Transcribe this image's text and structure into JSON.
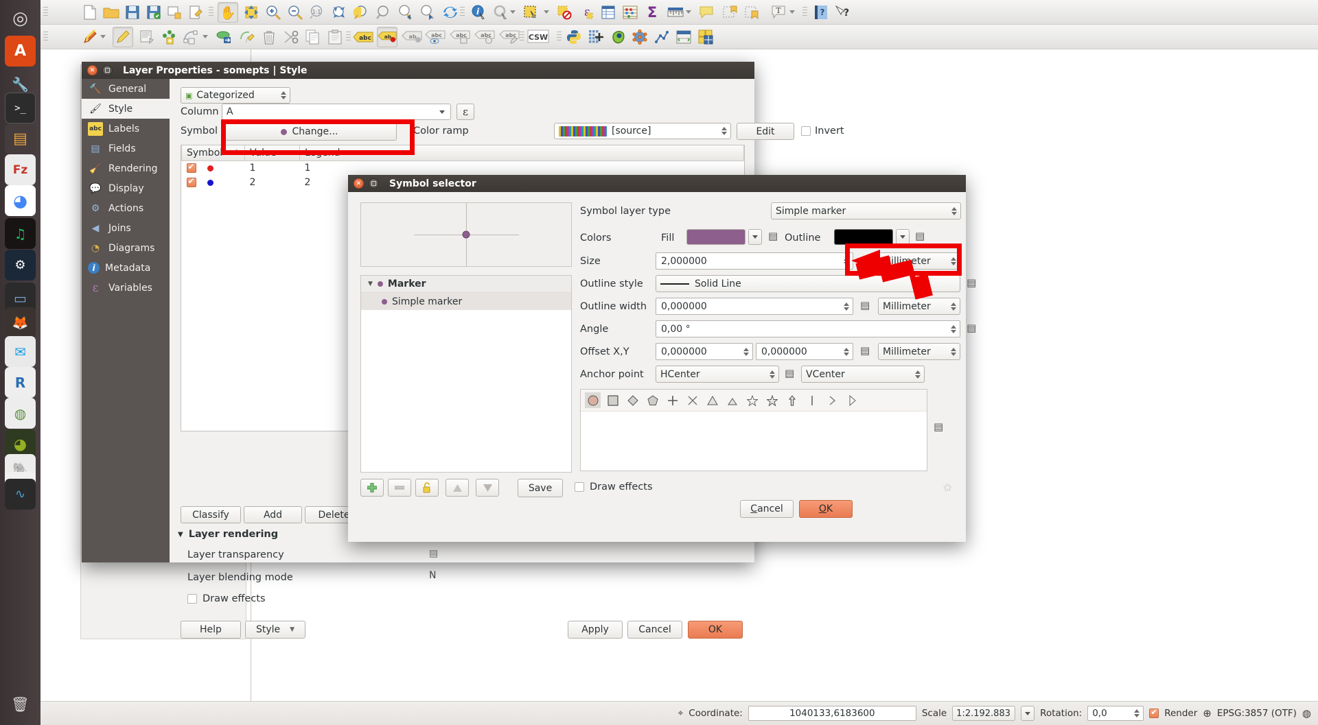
{
  "launcher": {
    "items": [
      {
        "name": "dash-home",
        "glyph": "◎",
        "color": "#d9d6d3",
        "bg": "transparent"
      },
      {
        "name": "app-ubuntu-software",
        "glyph": "A",
        "color": "#ffffff",
        "bg": "#dd4814"
      },
      {
        "name": "app-settings-wrench",
        "glyph": "🔧",
        "color": "#cfcfcf",
        "bg": "transparent"
      },
      {
        "name": "app-terminal",
        "glyph": ">_",
        "color": "#ffffff",
        "bg": "#2c2c2c"
      },
      {
        "name": "app-files",
        "glyph": "▤",
        "color": "#e8a33d",
        "bg": "#4a4042"
      },
      {
        "name": "app-filezilla",
        "glyph": "Fz",
        "color": "#c8362c",
        "bg": "#f0f0f0"
      },
      {
        "name": "app-chrome",
        "glyph": "◕",
        "color": "#4285f4",
        "bg": "#ffffff"
      },
      {
        "name": "app-spotify",
        "glyph": "♫",
        "color": "#1db954",
        "bg": "#191414"
      },
      {
        "name": "app-steam",
        "glyph": "⚙",
        "color": "#ffffff",
        "bg": "#1b2838"
      },
      {
        "name": "app-virtualbox",
        "glyph": "▭",
        "color": "#6d9fd4",
        "bg": "#2b2b2b"
      },
      {
        "name": "app-gimp",
        "glyph": "🦊",
        "color": "#dd8b3a",
        "bg": "#3a3330"
      },
      {
        "name": "app-thunderbird",
        "glyph": "✉",
        "color": "#1e9fe3",
        "bg": "#e8e8e8"
      },
      {
        "name": "app-rstudio",
        "glyph": "R",
        "color": "#2b6fb5",
        "bg": "#e8e8e8"
      },
      {
        "name": "app-qgis-old",
        "glyph": "Q",
        "color": "#5a8f3a",
        "bg": "#e0e0e0"
      },
      {
        "name": "app-qgis",
        "glyph": "Q",
        "color": "#93b023",
        "bg": "#2f3b20"
      },
      {
        "name": "app-pgadmin",
        "glyph": "🐘",
        "color": "#336791",
        "bg": "#e8e8e8"
      },
      {
        "name": "app-system-monitor",
        "glyph": "∿",
        "color": "#4ba3d8",
        "bg": "#2a2a2a"
      },
      {
        "name": "trash",
        "glyph": "🗑",
        "color": "#cfcfcf",
        "bg": "transparent"
      }
    ]
  },
  "toolbar1": {
    "items": [
      {
        "name": "grip-handle",
        "type": "grip"
      },
      {
        "name": "new-project-icon",
        "glyph": "🗎"
      },
      {
        "name": "open-project-icon",
        "glyph": "📂"
      },
      {
        "name": "save-project-icon",
        "glyph": "💾"
      },
      {
        "name": "save-project-as-icon",
        "glyph": "💾"
      },
      {
        "name": "new-print-composer-icon",
        "glyph": "🗋"
      },
      {
        "name": "composer-manager-icon",
        "glyph": "🗒"
      },
      {
        "name": "grip-handle",
        "type": "grip"
      },
      {
        "name": "pan-map-icon",
        "glyph": "✋",
        "pressed": true
      },
      {
        "name": "pan-to-selection-icon",
        "glyph": "✥"
      },
      {
        "name": "zoom-in-icon",
        "glyph": "🔍"
      },
      {
        "name": "zoom-out-icon",
        "glyph": "🔍"
      },
      {
        "name": "zoom-native-icon",
        "glyph": "1:1"
      },
      {
        "name": "zoom-full-icon",
        "glyph": "⤢"
      },
      {
        "name": "zoom-to-selection-icon",
        "glyph": "🔎"
      },
      {
        "name": "zoom-to-layer-icon",
        "glyph": "🔍"
      },
      {
        "name": "zoom-last-icon",
        "glyph": "🔍"
      },
      {
        "name": "zoom-next-icon",
        "glyph": "🔍"
      },
      {
        "name": "refresh-icon",
        "glyph": "🔄"
      },
      {
        "name": "grip-handle",
        "type": "grip"
      },
      {
        "name": "identify-features-icon",
        "glyph": "ⓘ"
      },
      {
        "name": "run-feature-action-icon",
        "glyph": "⚙"
      },
      {
        "name": "feature-action-dropdown-icon",
        "type": "arrow"
      },
      {
        "name": "select-features-icon",
        "glyph": "▦"
      },
      {
        "name": "select-dropdown-icon",
        "type": "arrow"
      },
      {
        "name": "deselect-features-icon",
        "glyph": "▢"
      },
      {
        "name": "select-by-expression-icon",
        "glyph": "ε"
      },
      {
        "name": "open-attribute-table-icon",
        "glyph": "▤"
      },
      {
        "name": "field-calculator-icon",
        "glyph": "🧮"
      },
      {
        "name": "statistical-summary-icon",
        "glyph": "Σ"
      },
      {
        "name": "measure-line-icon",
        "glyph": "📏"
      },
      {
        "name": "measure-dropdown-icon",
        "type": "arrow"
      },
      {
        "name": "map-tips-icon",
        "glyph": "💬"
      },
      {
        "name": "new-bookmark-icon",
        "glyph": "🔖"
      },
      {
        "name": "show-bookmarks-icon",
        "glyph": "🔖"
      },
      {
        "name": "text-annotation-icon",
        "glyph": "T"
      },
      {
        "name": "annotation-dropdown-icon",
        "type": "arrow"
      },
      {
        "name": "grip-handle",
        "type": "grip"
      },
      {
        "name": "help-contents-icon",
        "glyph": "?"
      },
      {
        "name": "whats-this-icon",
        "glyph": "?"
      }
    ]
  },
  "toolbar2": {
    "items": [
      {
        "name": "grip-handle",
        "type": "grip"
      },
      {
        "name": "current-edits-icon",
        "glyph": "✏"
      },
      {
        "name": "current-edits-dropdown-icon",
        "type": "arrow"
      },
      {
        "name": "toggle-editing-icon",
        "glyph": "✏",
        "pressed": true
      },
      {
        "name": "save-layer-edits-icon",
        "glyph": "🖫"
      },
      {
        "name": "add-feature-icon",
        "glyph": "⋮⋮"
      },
      {
        "name": "add-circular-string-icon",
        "glyph": "◠"
      },
      {
        "name": "add-curve-dropdown-icon",
        "type": "arrow"
      },
      {
        "name": "move-feature-icon",
        "glyph": "⬭"
      },
      {
        "name": "node-tool-icon",
        "glyph": "⚒"
      },
      {
        "name": "delete-selected-icon",
        "glyph": "🗑"
      },
      {
        "name": "cut-features-icon",
        "glyph": "✂"
      },
      {
        "name": "copy-features-icon",
        "glyph": "🗐"
      },
      {
        "name": "paste-features-icon",
        "glyph": "📋"
      },
      {
        "name": "grip-handle",
        "type": "grip"
      },
      {
        "name": "label-toolbar-icon",
        "glyph": "abc"
      },
      {
        "name": "highlight-pinned-labels-icon",
        "glyph": "ab",
        "pressed": true
      },
      {
        "name": "pin-labels-icon",
        "glyph": "ab"
      },
      {
        "name": "show-hide-labels-icon",
        "glyph": "abc"
      },
      {
        "name": "move-label-icon",
        "glyph": "abc"
      },
      {
        "name": "rotate-label-icon",
        "glyph": "abc"
      },
      {
        "name": "change-label-icon",
        "glyph": "abc"
      },
      {
        "name": "grip-handle",
        "type": "grip"
      },
      {
        "name": "metasearch-csw-icon",
        "glyph": "CSW"
      },
      {
        "name": "grip-handle",
        "type": "grip"
      },
      {
        "name": "python-console-icon",
        "glyph": "🐍"
      },
      {
        "name": "plugin-grid-icon",
        "glyph": "✚"
      },
      {
        "name": "qgis-plugin-icon",
        "glyph": "🫘"
      },
      {
        "name": "processing-toolbox-icon",
        "glyph": "⚛"
      },
      {
        "name": "graph-tool-icon",
        "glyph": "📈"
      },
      {
        "name": "table-manager-icon",
        "glyph": "▦"
      },
      {
        "name": "group-stats-icon",
        "glyph": "▩"
      }
    ]
  },
  "layer_properties": {
    "title": "Layer Properties - somepts | Style",
    "sidebar": [
      {
        "label": "General",
        "icon": "hammer-icon",
        "glyph": "🔨",
        "selected": false
      },
      {
        "label": "Style",
        "icon": "brush-icon",
        "glyph": "🖌",
        "selected": true
      },
      {
        "label": "Labels",
        "icon": "abc-label-icon",
        "glyph": "abc",
        "selected": false
      },
      {
        "label": "Fields",
        "icon": "table-icon",
        "glyph": "▤",
        "selected": false
      },
      {
        "label": "Rendering",
        "icon": "broom-icon",
        "glyph": "🧹",
        "selected": false
      },
      {
        "label": "Display",
        "icon": "speech-bubble-icon",
        "glyph": "💬",
        "selected": false
      },
      {
        "label": "Actions",
        "icon": "gear-play-icon",
        "glyph": "⚙",
        "selected": false
      },
      {
        "label": "Joins",
        "icon": "join-arrow-icon",
        "glyph": "◀",
        "selected": false
      },
      {
        "label": "Diagrams",
        "icon": "pie-chart-icon",
        "glyph": "◔",
        "selected": false
      },
      {
        "label": "Metadata",
        "icon": "info-icon",
        "glyph": "i",
        "selected": false
      },
      {
        "label": "Variables",
        "icon": "epsilon-icon",
        "glyph": "ε",
        "selected": false
      }
    ],
    "renderer_combo": "Categorized",
    "renderer_icon": "categorized-icon",
    "column_label": "Column",
    "column_value": "A",
    "expression_button_label": "ε",
    "symbol_label": "Symbol",
    "change_button_label": "Change...",
    "color_ramp_label": "Color ramp",
    "color_ramp_value": "[source]",
    "edit_button_label": "Edit",
    "invert_label": "Invert",
    "invert_checked": false,
    "table": {
      "headers": [
        "Symbol",
        "Value",
        "Legend"
      ],
      "sort_indicator": "▲",
      "rows": [
        {
          "checked": true,
          "symbol_color": "#e02020",
          "value": "1",
          "legend": "1"
        },
        {
          "checked": true,
          "symbol_color": "#1414d0",
          "value": "2",
          "legend": "2"
        }
      ]
    },
    "buttons": {
      "classify": "Classify",
      "add": "Add",
      "delete": "Delete"
    },
    "layer_rendering": {
      "section_title": "Layer rendering",
      "transparency_label": "Layer transparency",
      "blending_label": "Layer blending mode",
      "blending_value": "Normal",
      "draw_effects_label": "Draw effects",
      "draw_effects_checked": false
    },
    "footer": {
      "help": "Help",
      "style": "Style",
      "apply": "Apply",
      "cancel": "Cancel",
      "ok": "OK"
    }
  },
  "symbol_selector": {
    "title": "Symbol selector",
    "tree": {
      "root_label": "Marker",
      "child_label": "Simple marker",
      "root_expand_glyph": "▼",
      "child_dot_color": "#8d5f8c"
    },
    "preview": {
      "marker_color": "#8d5f8c",
      "crosshair": true
    },
    "fields": {
      "symbol_layer_type_label": "Symbol layer type",
      "symbol_layer_type_value": "Simple marker",
      "colors_label": "Colors",
      "fill_label": "Fill",
      "fill_color": "#8d5f8c",
      "outline_label": "Outline",
      "outline_color": "#000000",
      "size_label": "Size",
      "size_value": "2,000000",
      "size_unit": "Millimeter",
      "outline_style_label": "Outline style",
      "outline_style_value": "Solid Line",
      "outline_width_label": "Outline width",
      "outline_width_value": "0,000000",
      "outline_width_unit": "Millimeter",
      "angle_label": "Angle",
      "angle_value": "0,00 °",
      "offset_label": "Offset X,Y",
      "offset_x_value": "0,000000",
      "offset_y_value": "0,000000",
      "offset_unit": "Millimeter",
      "anchor_label": "Anchor point",
      "anchor_h_value": "HCenter",
      "anchor_v_value": "VCenter"
    },
    "shapes": [
      {
        "name": "circle-shape",
        "glyph": "●",
        "selected": true
      },
      {
        "name": "square-shape",
        "glyph": "■",
        "selected": false
      },
      {
        "name": "diamond-shape",
        "glyph": "◆",
        "selected": false
      },
      {
        "name": "pentagon-shape",
        "glyph": "⬟",
        "selected": false
      },
      {
        "name": "cross-shape",
        "glyph": "+",
        "selected": false
      },
      {
        "name": "x-shape",
        "glyph": "✕",
        "selected": false
      },
      {
        "name": "triangle-shape",
        "glyph": "▲",
        "selected": false
      },
      {
        "name": "equilateral-triangle-shape",
        "glyph": "▲",
        "selected": false
      },
      {
        "name": "star-outline-shape",
        "glyph": "✩",
        "selected": false
      },
      {
        "name": "star-shape",
        "glyph": "★",
        "selected": false
      },
      {
        "name": "arrow-up-shape",
        "glyph": "⇧",
        "selected": false
      },
      {
        "name": "line-shape",
        "glyph": "|",
        "selected": false
      },
      {
        "name": "arrow-right-shape",
        "glyph": "›",
        "selected": false
      },
      {
        "name": "half-triangle-shape",
        "glyph": "▷",
        "selected": false
      }
    ],
    "bottom_buttons": {
      "add_layer": "＋",
      "remove_layer": "－",
      "lock_layer": "🔓",
      "move_up": "▲",
      "move_down": "▼",
      "save": "Save"
    },
    "draw_effects_label": "Draw effects",
    "draw_effects_checked": false,
    "cancel": "Cancel",
    "ok": "OK"
  },
  "statusbar": {
    "locator_icon": "pointer-icon",
    "coordinate_label": "Coordinate:",
    "coordinate_value": "1040133,6183600",
    "scale_label": "Scale",
    "scale_value": "1:2.192.883",
    "rotation_label": "Rotation:",
    "rotation_value": "0,0",
    "render_label": "Render",
    "render_checked": true,
    "crs_label": "EPSG:3857 (OTF)",
    "messages_icon": "message-icon"
  },
  "colors": {
    "accent_orange": "#e98253",
    "annotation_red": "#ef0000",
    "dialog_bg": "#f2f1f0",
    "titlebar": "#3c3835",
    "sidebar_dark": "#5a5452"
  }
}
